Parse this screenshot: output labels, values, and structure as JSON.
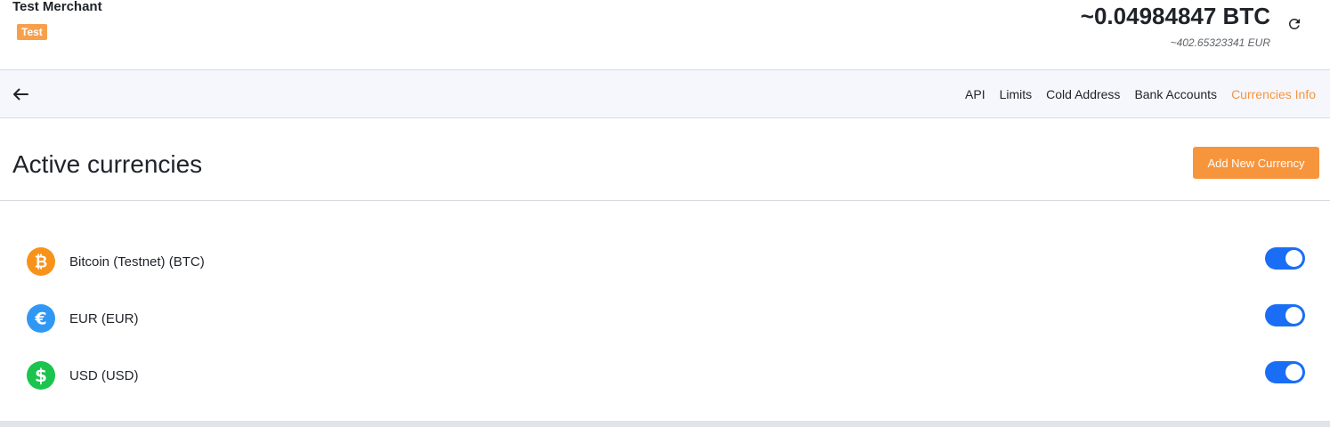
{
  "header": {
    "merchant_name": "Test Merchant",
    "environment_badge": "Test",
    "balance_crypto": "~0.04984847 BTC",
    "balance_fiat": "~402.65323341 EUR",
    "refresh_icon": "refresh-icon"
  },
  "nav": {
    "back_icon": "arrow-left-icon",
    "links": [
      {
        "label": "API",
        "active": false
      },
      {
        "label": "Limits",
        "active": false
      },
      {
        "label": "Cold Address",
        "active": false
      },
      {
        "label": "Bank Accounts",
        "active": false
      },
      {
        "label": "Currencies Info",
        "active": true
      }
    ]
  },
  "section": {
    "title": "Active currencies",
    "add_button_label": "Add New Currency"
  },
  "currencies": [
    {
      "label": "Bitcoin (Testnet) (BTC)",
      "icon": "bitcoin-icon",
      "color": "#f7931a",
      "enabled": true
    },
    {
      "label": "EUR (EUR)",
      "icon": "euro-icon",
      "color": "#2f98f5",
      "enabled": true
    },
    {
      "label": "USD (USD)",
      "icon": "dollar-icon",
      "color": "#1bc44e",
      "enabled": true
    }
  ],
  "colors": {
    "accent": "#f7953d",
    "toggle_on": "#1a6ef5",
    "nav_background": "#f5f7fc"
  }
}
